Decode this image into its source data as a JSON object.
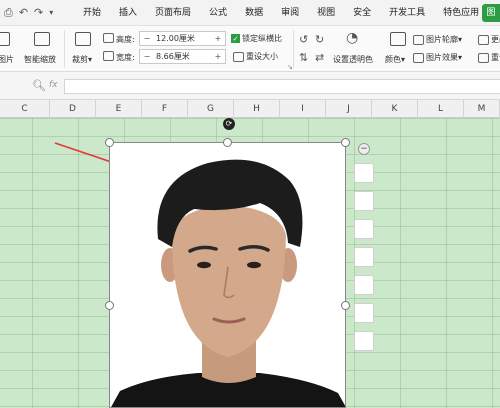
{
  "menubar": {
    "items": [
      "开始",
      "插入",
      "页面布局",
      "公式",
      "数据",
      "审阅",
      "视图",
      "安全",
      "开发工具",
      "特色应用"
    ],
    "tab_pill": "图"
  },
  "ribbon": {
    "image_label": "图片",
    "smart_zoom": "智能缩放",
    "crop": "裁剪",
    "height_label": "高度:",
    "height_value": "12.00厘米",
    "width_label": "宽度:",
    "width_value": "8.66厘米",
    "lock_ratio": "锁定纵横比",
    "reset_size": "重设大小",
    "set_transparent": "设置透明色",
    "color": "颜色",
    "picture_outline": "图片轮廓",
    "picture_effect": "图片效果",
    "change": "更改",
    "reset": "重设"
  },
  "formula_bar": {
    "fx": "fx"
  },
  "columns": [
    "C",
    "D",
    "E",
    "F",
    "G",
    "H",
    "I",
    "J",
    "K",
    "L",
    "M"
  ],
  "colors": {
    "accent": "#2e9c45",
    "grid": "#cbe8cb",
    "arrow": "#e53935"
  }
}
